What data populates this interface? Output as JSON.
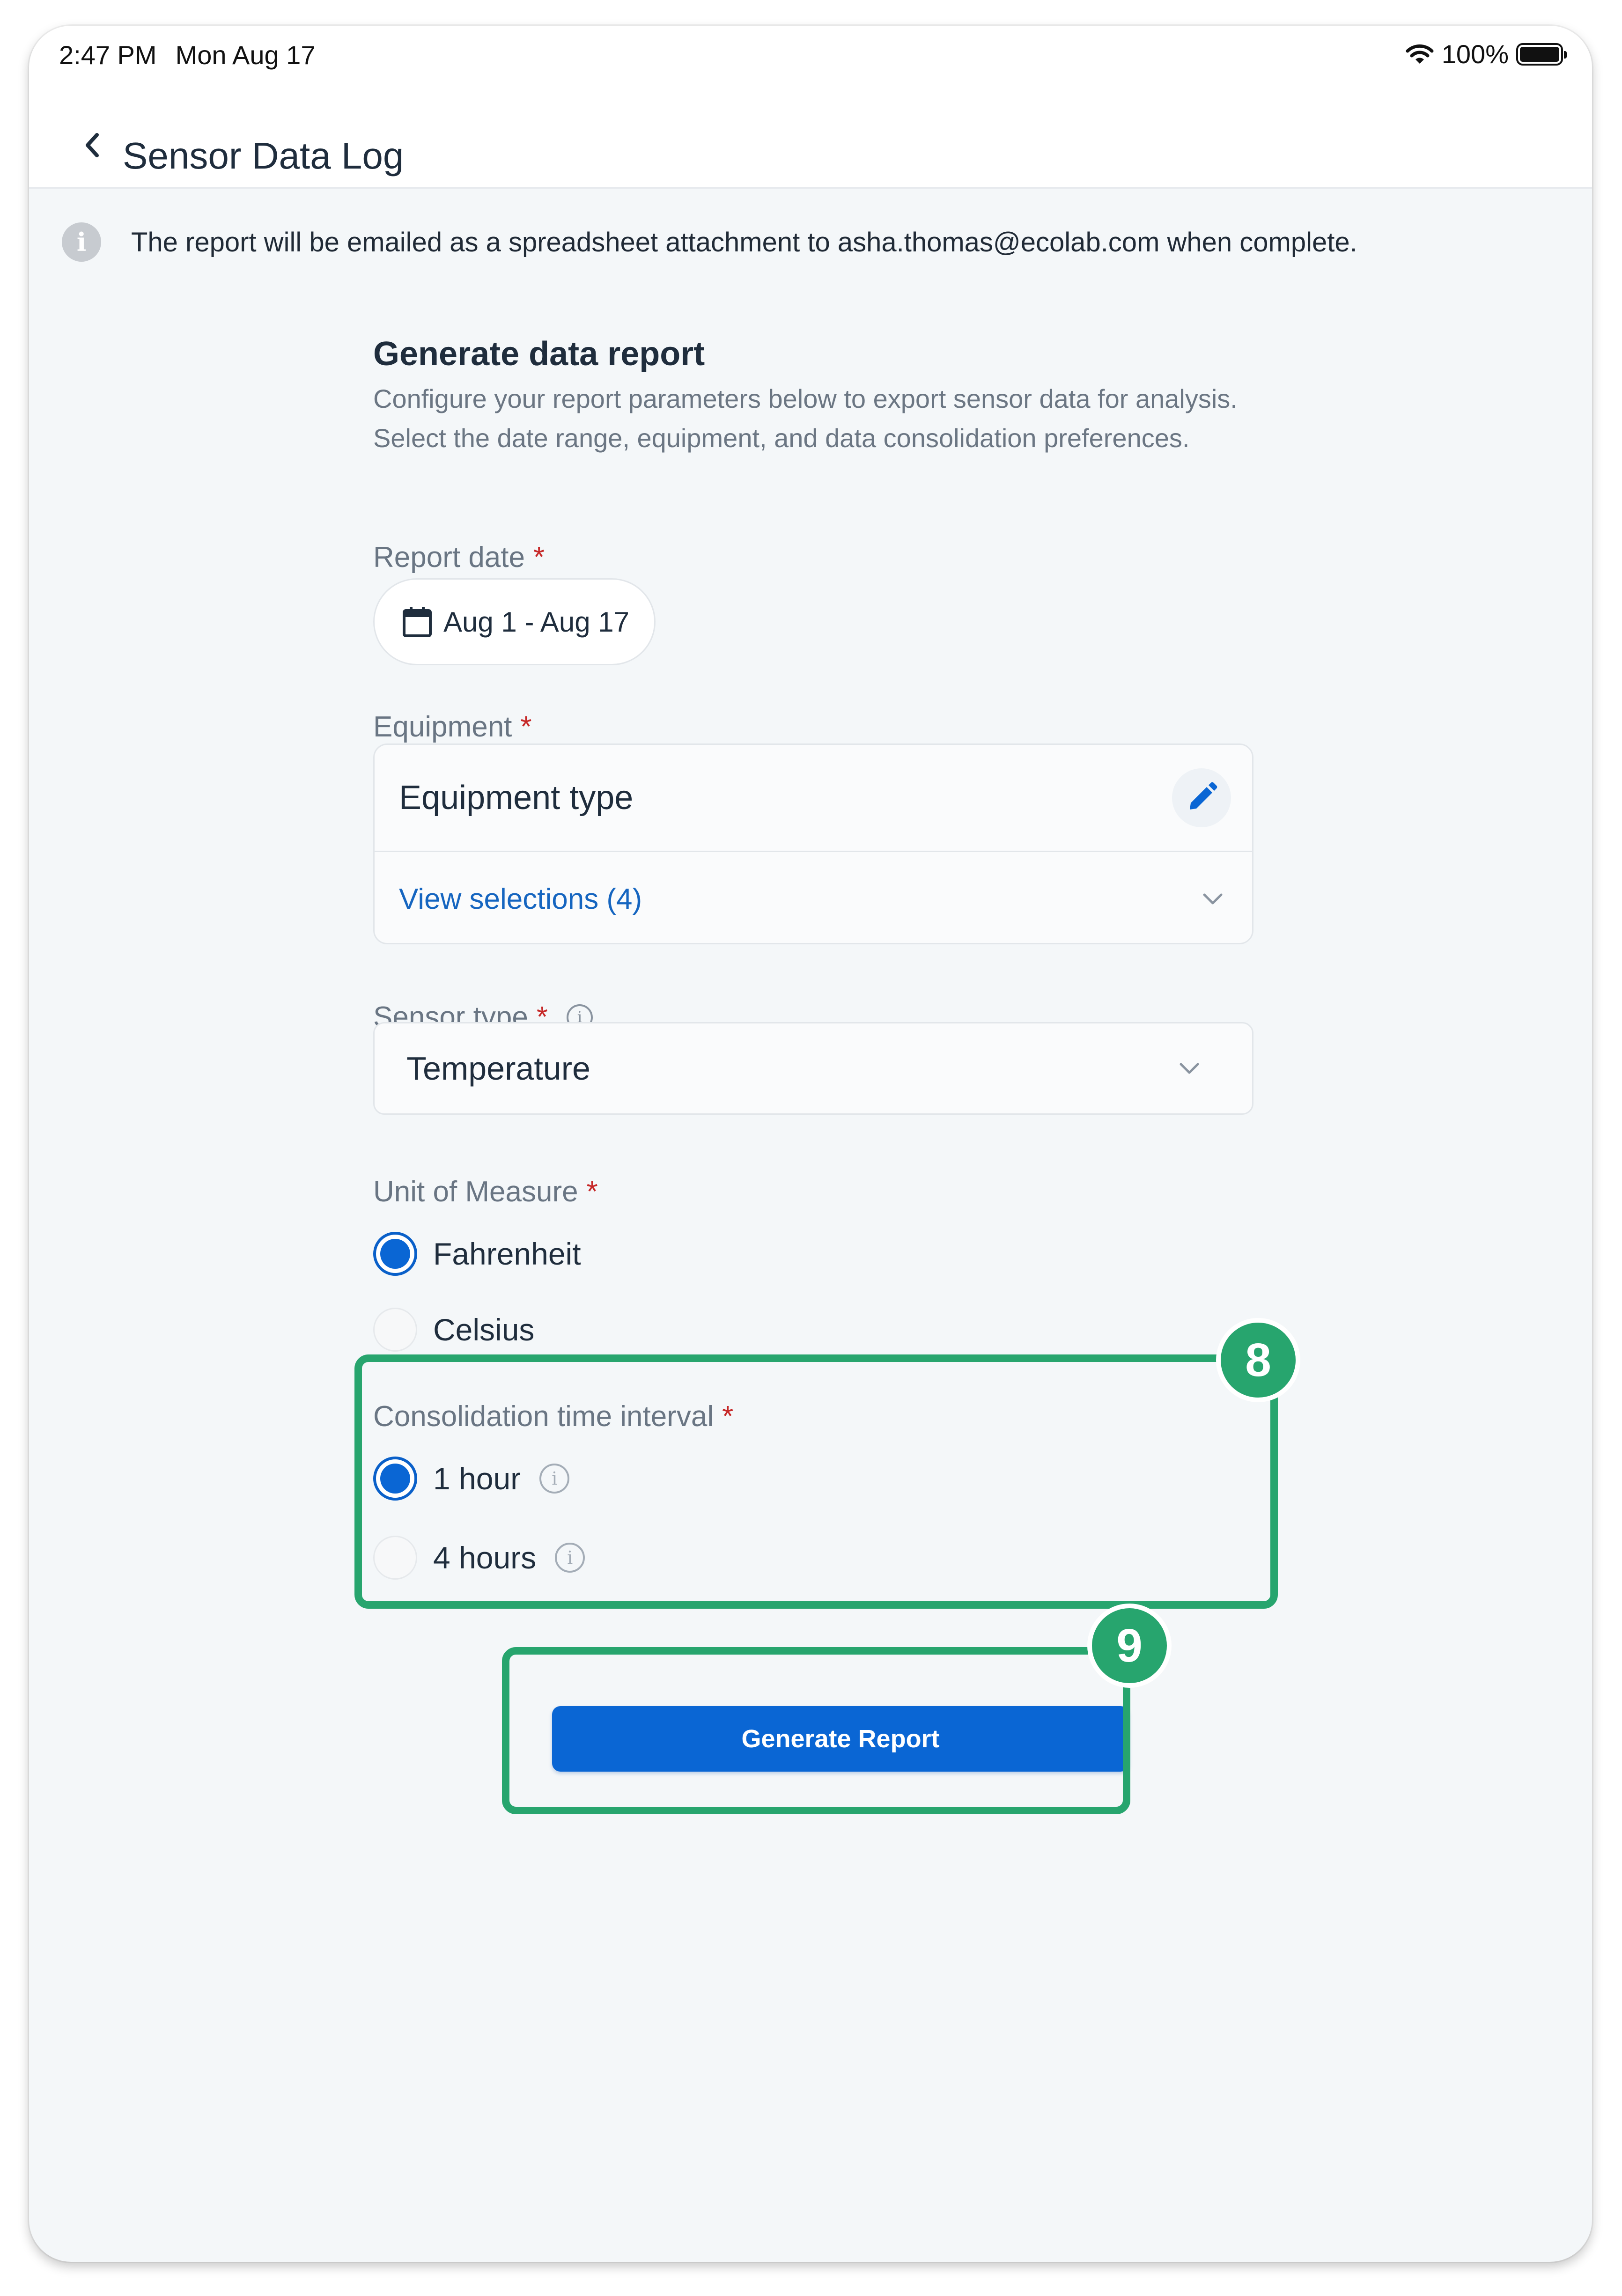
{
  "status_bar": {
    "time": "2:47 PM",
    "date": "Mon Aug 17",
    "battery": "100%"
  },
  "nav": {
    "title": "Sensor Data Log",
    "back_icon": "chevron-left-icon"
  },
  "info_banner": {
    "text": "The report will be emailed as a spreadsheet attachment to asha.thomas@ecolab.com when complete."
  },
  "form": {
    "heading": "Generate data report",
    "description": "Configure your report parameters below to export sensor data for analysis. Select the date range, equipment, and data consolidation preferences.",
    "report_date": {
      "label": "Report date",
      "required": "*",
      "value": "Aug 1 - Aug 17"
    },
    "equipment": {
      "label": "Equipment",
      "required": "*",
      "field": "Equipment type",
      "selections_link": "View selections (4)"
    },
    "sensor_type": {
      "label": "Sensor type",
      "required": "*",
      "value": "Temperature"
    },
    "unit_of_measure": {
      "label": "Unit of Measure",
      "required": "*",
      "options": [
        {
          "label": "Fahrenheit",
          "selected": true
        },
        {
          "label": "Celsius",
          "selected": false
        }
      ]
    },
    "consolidation": {
      "label": "Consolidation time interval",
      "required": "*",
      "options": [
        {
          "label": "1 hour",
          "selected": true
        },
        {
          "label": "4 hours",
          "selected": false
        }
      ]
    },
    "submit_label": "Generate Report"
  },
  "callouts": {
    "interval_badge": "8",
    "button_badge": "9"
  },
  "colors": {
    "accent": "#0a66d4",
    "callout": "#27a56e",
    "required": "#c62828"
  }
}
